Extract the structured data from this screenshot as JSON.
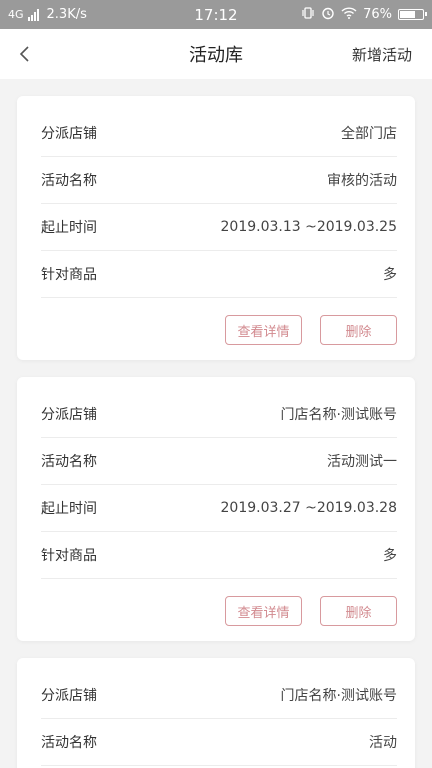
{
  "status_bar": {
    "network": "4G",
    "speed": "2.3K/s",
    "time": "17:12",
    "battery": "76%",
    "battery_level": 0.76
  },
  "nav": {
    "title": "活动库",
    "action": "新增活动"
  },
  "labels": {
    "store": "分派店铺",
    "name": "活动名称",
    "period": "起止时间",
    "goods": "针对商品"
  },
  "cards": [
    {
      "store": "全部门店",
      "name": "审核的活动",
      "period": "2019.03.13 ~2019.03.25",
      "goods": "多",
      "detail_label": "查看详情",
      "delete_label": "删除"
    },
    {
      "store": "门店名称·测试账号",
      "name": "活动测试一",
      "period": "2019.03.27 ~2019.03.28",
      "goods": "多",
      "detail_label": "查看详情",
      "delete_label": "删除"
    },
    {
      "store": "门店名称·测试账号",
      "name": "活动"
    }
  ],
  "colors": {
    "status_bar_bg": "#9a9a9a",
    "button_accent": "#d28a8f",
    "page_bg": "#f3f3f3"
  }
}
